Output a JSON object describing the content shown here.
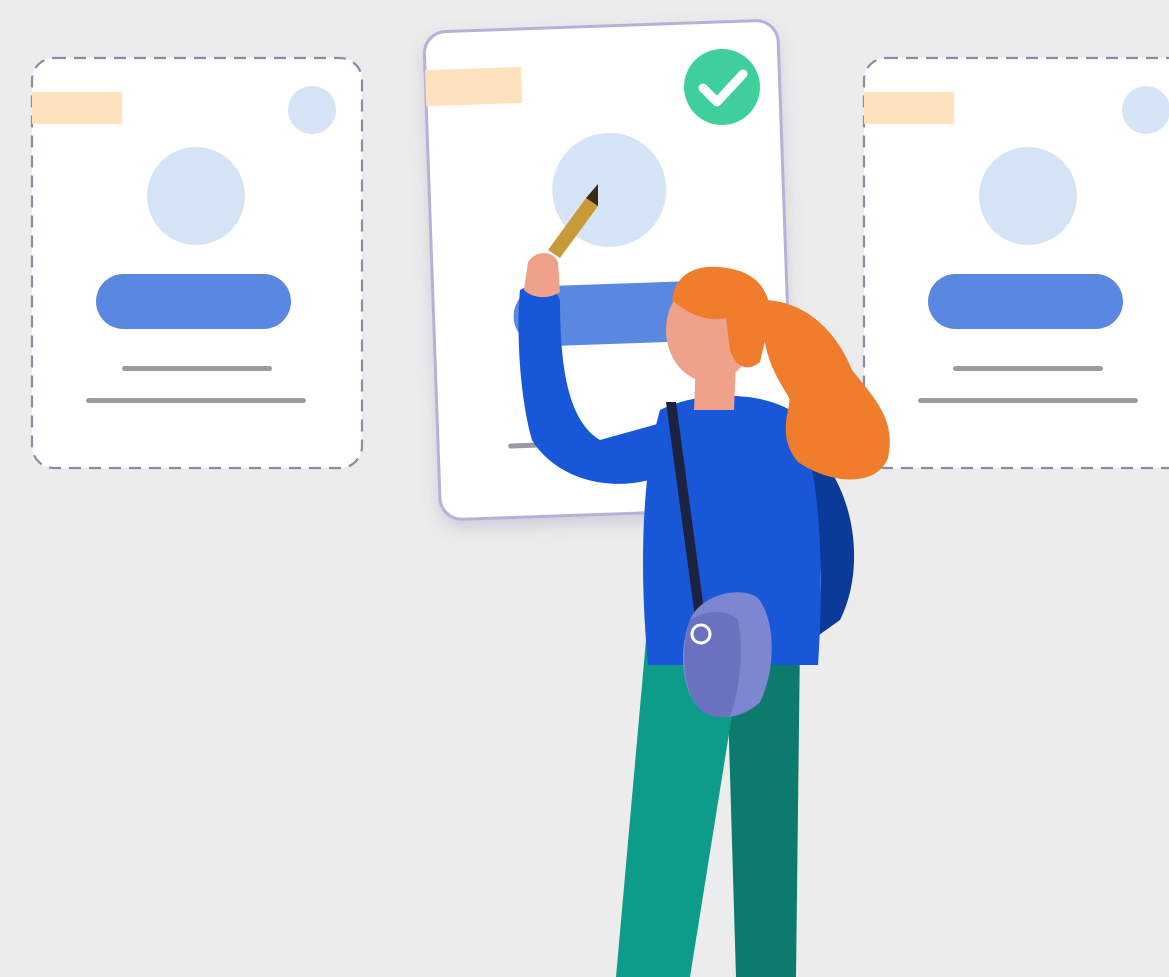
{
  "colors": {
    "background": "#ececec",
    "card_fill": "#ffffff",
    "card_dashed_border": "#8f8aa8",
    "card_selected_border": "#b6b1d6",
    "header_tag": "#fde2bd",
    "avatar_circle": "#d6e4f7",
    "primary_button": "#5a87e0",
    "text_line": "#9a9aa2",
    "check_badge": "#3fcf9a",
    "hair": "#ef7d2b",
    "skin": "#f0a18a",
    "shirt": "#1857d8",
    "shirt_shadow": "#0c3a9a",
    "bag": "#7d86d0",
    "bag_strap": "#1c2240",
    "pants_front": "#0e9c8a",
    "pants_back": "#0c7a6d",
    "pencil": "#c79a3a"
  },
  "cards": [
    {
      "id": "left",
      "state": "unselected",
      "icon": "small-dot-icon"
    },
    {
      "id": "center",
      "state": "selected",
      "icon": "check-badge-icon"
    },
    {
      "id": "right",
      "state": "unselected",
      "icon": "small-dot-icon"
    }
  ],
  "illustration": {
    "figure": "woman-with-pencil",
    "accessory": "shoulder-bag"
  }
}
